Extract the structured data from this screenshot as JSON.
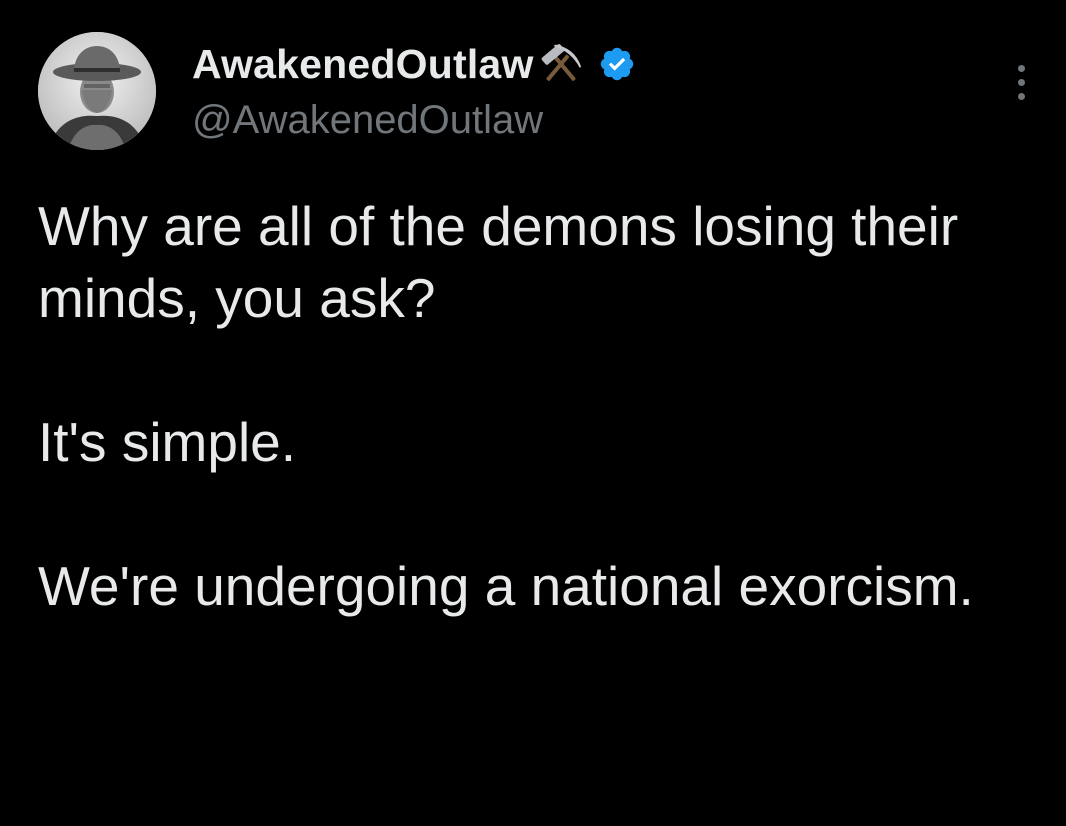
{
  "author": {
    "display_name": "AwakenedOutlaw",
    "name_emoji": "hammer-and-pick-icon",
    "verified": true,
    "handle": "@AwakenedOutlaw"
  },
  "tweet": {
    "paragraphs": [
      "Why are all of the demons losing their minds, you ask?",
      "It's simple.",
      "We're undergoing a national exorcism."
    ]
  },
  "colors": {
    "background": "#000000",
    "text_primary": "#e7e9ea",
    "text_secondary": "#71767b",
    "verified_blue": "#1d9bf0"
  },
  "icons": {
    "more": "more-vertical-icon",
    "verified": "verified-badge-icon"
  }
}
